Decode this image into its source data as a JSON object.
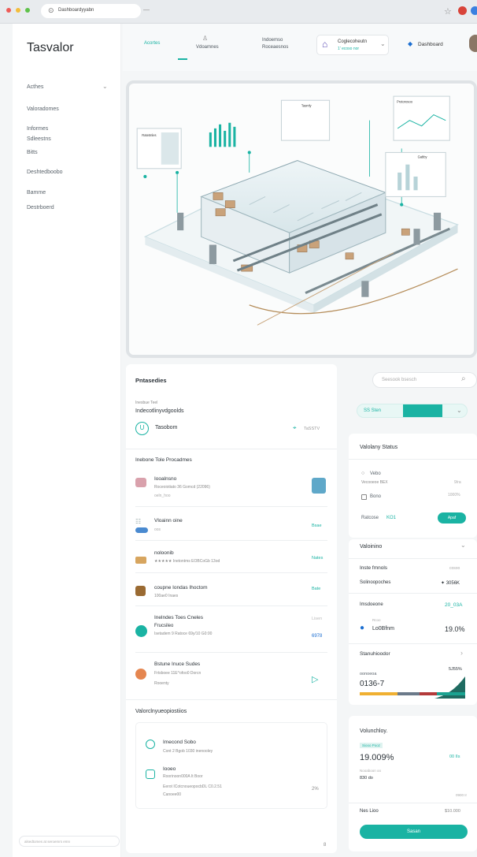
{
  "browser": {
    "url": "Dashboardyyabn",
    "newtab": "—",
    "star": "☆"
  },
  "sidebar": {
    "brand": "Tasvalor",
    "items": [
      {
        "label": "Acthes"
      },
      {
        "label": "Valoradomes"
      },
      {
        "label": "Informes"
      },
      {
        "label": "Sdleestns"
      },
      {
        "label": "Bitts"
      },
      {
        "label": "Deshtedboobo"
      },
      {
        "label": "Bamme"
      },
      {
        "label": "Destrboerd"
      }
    ],
    "footer": "alsedtomes at seroemrs emn"
  },
  "topbar": {
    "tabs": [
      {
        "label": "Acortes"
      },
      {
        "label": "Vdoamnes"
      },
      {
        "label": "Indoemso"
      },
      {
        "label": "Roceaesnos"
      }
    ],
    "lang": {
      "title": "Coglecoheutn",
      "sub": "1' ecoso nor"
    },
    "dashboard": "Dashboard"
  },
  "hero": {
    "panel_a": "Ratetmles",
    "panel_b": "Tasmly",
    "panel_c": "Protorosoo",
    "panel_d": "Gabby"
  },
  "left": {
    "title": "Pntasedies",
    "search": "Seesook bsesch",
    "sub_small": "Inesbue Teel",
    "sub_title": "Indecotlinyvdgoolds",
    "chip_label": "Tasobom",
    "chip_right": "TaSSTV",
    "section1": "Inebone Tole Procadmes",
    "rows": [
      {
        "title": "Iooalnsno",
        "line1": "Roceoiotiato 36 Gomcd (22096)",
        "line2": "oeln_hoo",
        "action": ""
      },
      {
        "title": "Vloainn oine",
        "line1": "oos",
        "line2": "",
        "action": "Bsae"
      },
      {
        "title": "noloonib",
        "line1": "★★★★★ Inetontms EOBCoGb 13od",
        "line2": "",
        "action": "Nates"
      },
      {
        "title": "coupne Iondas Ihoctom",
        "line1": "100ae0 Inaes",
        "line2": "",
        "action": "Bate"
      },
      {
        "title": "Inelndes Toes Cneles",
        "line1": "Frucsileo",
        "line2": "Isetadem 9 Ratoce 69y/10 G0:00",
        "action": "Lisen",
        "value": "6978"
      },
      {
        "title": "Bstune Inuce Sudes",
        "line1": "Frtsboee 11E^ofoo0 Dorcn",
        "line2": "Rooenty",
        "action": "▷"
      }
    ],
    "section2": "Valorclnyueopiostiios",
    "sub_rows": [
      {
        "title": "Imecond Sobo",
        "line1": "Cont 2 Bgob 1030 inenooley"
      },
      {
        "title": "Iooeo",
        "line1": "Roorinoon000A It Boor",
        "line2": "Eerot  ICotcnoueopocbDL C0.2.51",
        "line3": "Canoee00",
        "value": "2%"
      }
    ],
    "page_number": "8"
  },
  "right": {
    "select_label": "SS Sten",
    "status_title": "Valolany Status",
    "opt1": "Vebo",
    "opt2": "Bono",
    "row1_label": "Vecooeoe BEX",
    "row1_val": "9/ra",
    "row2_val": "1000%",
    "kpi_label": "Ratcose",
    "kpi_code": "KO1",
    "kpi_btn": "Apaf",
    "valores_title": "Valoinino",
    "v_rows": [
      {
        "label": "Inste fmnols",
        "value": "cosoo"
      },
      {
        "label": "Solinoopoches",
        "value": "✦ 3056K"
      },
      {
        "label": "Imsdoeone",
        "value": "20_03A"
      }
    ],
    "loc_small": "Rcoo",
    "loc_label": "Lo0Bfnm",
    "loc_val": "19.0%",
    "stats_title": "Stanuhioodor",
    "stats_small": "oonoeoa",
    "stats_val": "5J55%",
    "stats_big": "0136-7",
    "bottom_title": "Volunchloy.",
    "pill": "Siooo Pooz",
    "big": "19.009%",
    "big_right": "00 IIs",
    "meta1": "Nooaboon oo",
    "meta2": "830 do",
    "meta3": "0900 Ir",
    "total_label": "Nes Lioo",
    "total_val": "$10.000",
    "final_btn": "Sasan"
  },
  "colors": {
    "accent": "#1ab3a3",
    "bar_a": "#f0b032",
    "bar_b": "#6b7a8a",
    "bar_c": "#b33a3a",
    "bar_d": "#1aa391"
  }
}
